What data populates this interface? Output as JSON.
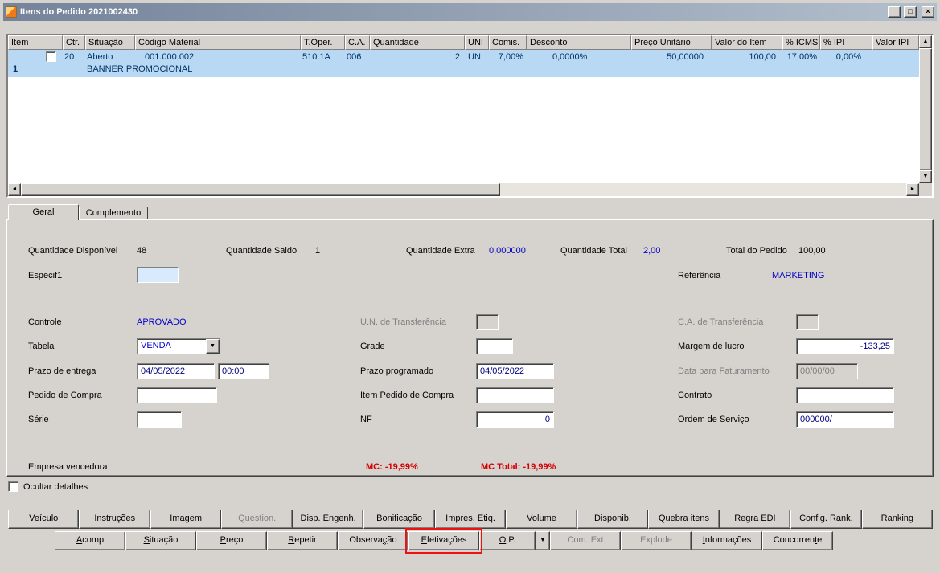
{
  "window": {
    "title": "Itens do Pedido 2021002430"
  },
  "icons": {
    "app": "css-shape",
    "minimize": "_",
    "maximize": "□",
    "close": "×",
    "dropdown": "▼",
    "scroll_up": "▲",
    "scroll_down": "▼",
    "scroll_left": "◄",
    "scroll_right": "►"
  },
  "colors": {
    "selected_row": "#b8d8f4",
    "value_blue": "#0000c8",
    "alert_red": "#d40000",
    "annotation_red": "#ee1111",
    "titlebar_left": "#74839b",
    "titlebar_right": "#b3bfcc"
  },
  "grid": {
    "headers": [
      "Item",
      "Ctr.",
      "Situação",
      "Código Material",
      "T.Oper.",
      "C.A.",
      "Quantidade",
      "UNI",
      "Comis.",
      "Desconto",
      "Preço Unitário",
      "Valor do Item",
      "% ICMS",
      "% IPI",
      "Valor IPI"
    ],
    "row": {
      "item": "1",
      "ctr": "20",
      "situacao": "Aberto",
      "codigo_material": "001.000.002",
      "t_oper": "510.1A",
      "ca": "006",
      "quantidade": "2",
      "uni": "UN",
      "comis": "7,00%",
      "desconto": "0,0000%",
      "preco_unitario": "50,00000",
      "valor_item": "100,00",
      "perc_icms": "17,00%",
      "perc_ipi": "0,00%",
      "valor_ipi": "",
      "descricao": "BANNER PROMOCIONAL"
    }
  },
  "tabs": {
    "geral": "Geral",
    "complemento": "Complemento"
  },
  "form": {
    "quantidade_disponivel": {
      "label": "Quantidade Disponível",
      "value": "48"
    },
    "quantidade_saldo": {
      "label": "Quantidade Saldo",
      "value": "1"
    },
    "quantidade_extra": {
      "label": "Quantidade Extra",
      "value": "0,000000"
    },
    "quantidade_total": {
      "label": "Quantidade Total",
      "value": "2,00"
    },
    "total_do_pedido": {
      "label": "Total do Pedido",
      "value": "100,00"
    },
    "especif1": {
      "label": "Especif1",
      "value": ""
    },
    "referencia": {
      "label": "Referência",
      "value": "MARKETING"
    },
    "controle": {
      "label": "Controle",
      "value": "APROVADO"
    },
    "un_transferencia": {
      "label": "U.N. de Transferência",
      "value": ""
    },
    "ca_transferencia": {
      "label": "C.A. de Transferência",
      "value": ""
    },
    "tabela": {
      "label": "Tabela",
      "value": "VENDA"
    },
    "grade": {
      "label": "Grade",
      "value": ""
    },
    "margem_de_lucro": {
      "label": "Margem de lucro",
      "value": "-133,25"
    },
    "prazo_de_entrega": {
      "label": "Prazo de entrega",
      "date": "04/05/2022",
      "time": "00:00"
    },
    "prazo_programado": {
      "label": "Prazo programado",
      "value": "04/05/2022"
    },
    "data_para_faturamento": {
      "label": "Data para Faturamento",
      "value": "00/00/00"
    },
    "pedido_de_compra": {
      "label": "Pedido de Compra",
      "value": ""
    },
    "item_pedido_de_compra": {
      "label": "Item Pedido de Compra",
      "value": ""
    },
    "contrato": {
      "label": "Contrato",
      "value": ""
    },
    "serie": {
      "label": "Série",
      "value": ""
    },
    "nf": {
      "label": "NF",
      "value": "0"
    },
    "ordem_de_servico": {
      "label": "Ordem de Serviço",
      "value": "000000/"
    },
    "empresa_vencedora_label": "Empresa vencedora",
    "mc": "MC: -19,99%",
    "mc_total": "MC Total: -19,99%"
  },
  "footer": {
    "ocultar_detalhes": "Ocultar detalhes",
    "row1": [
      {
        "html": "Veícu<u>l</u>o",
        "enabled": true
      },
      {
        "html": "Ins<u>t</u>ruções",
        "enabled": true
      },
      {
        "html": "Ima<u>g</u>em",
        "enabled": true
      },
      {
        "html": "Question.",
        "enabled": false
      },
      {
        "html": "Disp. Engenh.",
        "enabled": true
      },
      {
        "html": "Bonifi<u>c</u>ação",
        "enabled": true
      },
      {
        "html": "Impres. Etiq.",
        "enabled": true
      },
      {
        "html": "<u>V</u>olume",
        "enabled": true
      },
      {
        "html": "<u>D</u>isponib.",
        "enabled": true
      },
      {
        "html": "Que<u>b</u>ra itens",
        "enabled": true
      },
      {
        "html": "Re<u>g</u>ra EDI",
        "enabled": true
      },
      {
        "html": "Config. Rank.",
        "enabled": true
      },
      {
        "html": "Ranking",
        "enabled": true
      }
    ],
    "row2": [
      {
        "html": "<u>A</u>comp",
        "enabled": true
      },
      {
        "html": "<u>S</u>ituação",
        "enabled": true
      },
      {
        "html": "<u>P</u>reço",
        "enabled": true
      },
      {
        "html": "<u>R</u>epetir",
        "enabled": true
      },
      {
        "html": "Observa<u>ç</u>ão",
        "enabled": true
      },
      {
        "html": "<u>E</u>fetivações",
        "enabled": true,
        "highlighted": true
      },
      {
        "html": "<u>O</u>.P.",
        "enabled": true
      },
      {
        "html": "Com. Ext",
        "enabled": false
      },
      {
        "html": "Explode",
        "enabled": false
      },
      {
        "html": "<u>I</u>nformações",
        "enabled": true
      },
      {
        "html": "Concorren<u>t</u>e",
        "enabled": true
      }
    ]
  }
}
